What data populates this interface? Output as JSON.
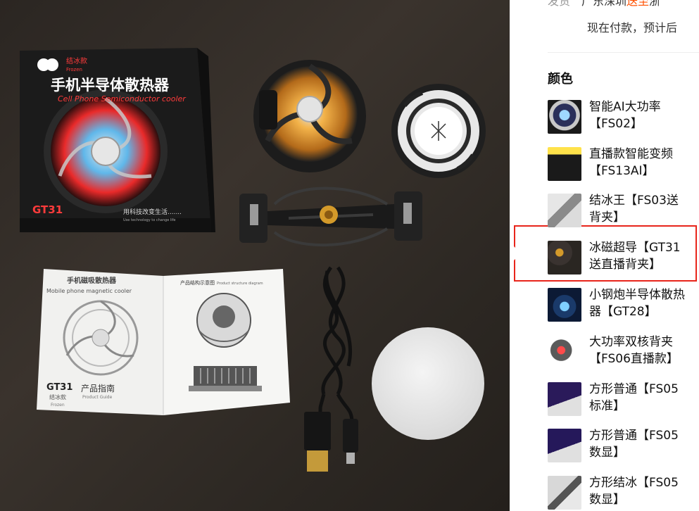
{
  "photo": {
    "box_brand": "结冰款",
    "box_brand_sub": "Frozen",
    "box_title": "手机半导体散热器",
    "box_subtitle": "Cell Phone Semiconductor cooler",
    "box_model": "GT31",
    "box_slogan": "用科技改变生活.......",
    "box_slogan_sub": "Use technology to change life",
    "manual_left_title": "手机磁吸散热器",
    "manual_left_subtitle": "Mobile phone magnetic cooler",
    "manual_model": "GT31",
    "manual_model_sub": "结冰款",
    "manual_model_sub2": "Frozen",
    "manual_guide": "产品指南",
    "manual_guide_sub": "Product Guide",
    "manual_right_title": "产品结构示意图",
    "manual_right_title_en": "Product structure diagram"
  },
  "shipping": {
    "label": "发货",
    "text_a": "广东深圳",
    "text_hl": "送至",
    "text_b": "浙",
    "line2": "现在付款，预计后"
  },
  "color_section": {
    "title": "颜色",
    "options": [
      {
        "line1": "智能AI大功率",
        "line2": "【FS02】",
        "selected": false
      },
      {
        "line1": "直播款智能变频",
        "line2": "【FS13AI】",
        "selected": false
      },
      {
        "line1": "结冰王【FS03送",
        "line2": "背夹】",
        "selected": false
      },
      {
        "line1": "冰磁超导【GT31",
        "line2": "送直播背夹】",
        "selected": true
      },
      {
        "line1": "小钢炮半导体散热",
        "line2": "器【GT28】",
        "selected": false
      },
      {
        "line1": "大功率双核背夹",
        "line2": "【FS06直播款】",
        "selected": false
      },
      {
        "line1": "方形普通【FS05",
        "line2": "标准】",
        "selected": false
      },
      {
        "line1": "方形普通【FS05",
        "line2": "数显】",
        "selected": false
      },
      {
        "line1": "方形结冰【FS05",
        "line2": "数显】",
        "selected": false
      }
    ]
  },
  "colors": {
    "accent": "#ff5000",
    "highlight_border": "#e8251b"
  }
}
